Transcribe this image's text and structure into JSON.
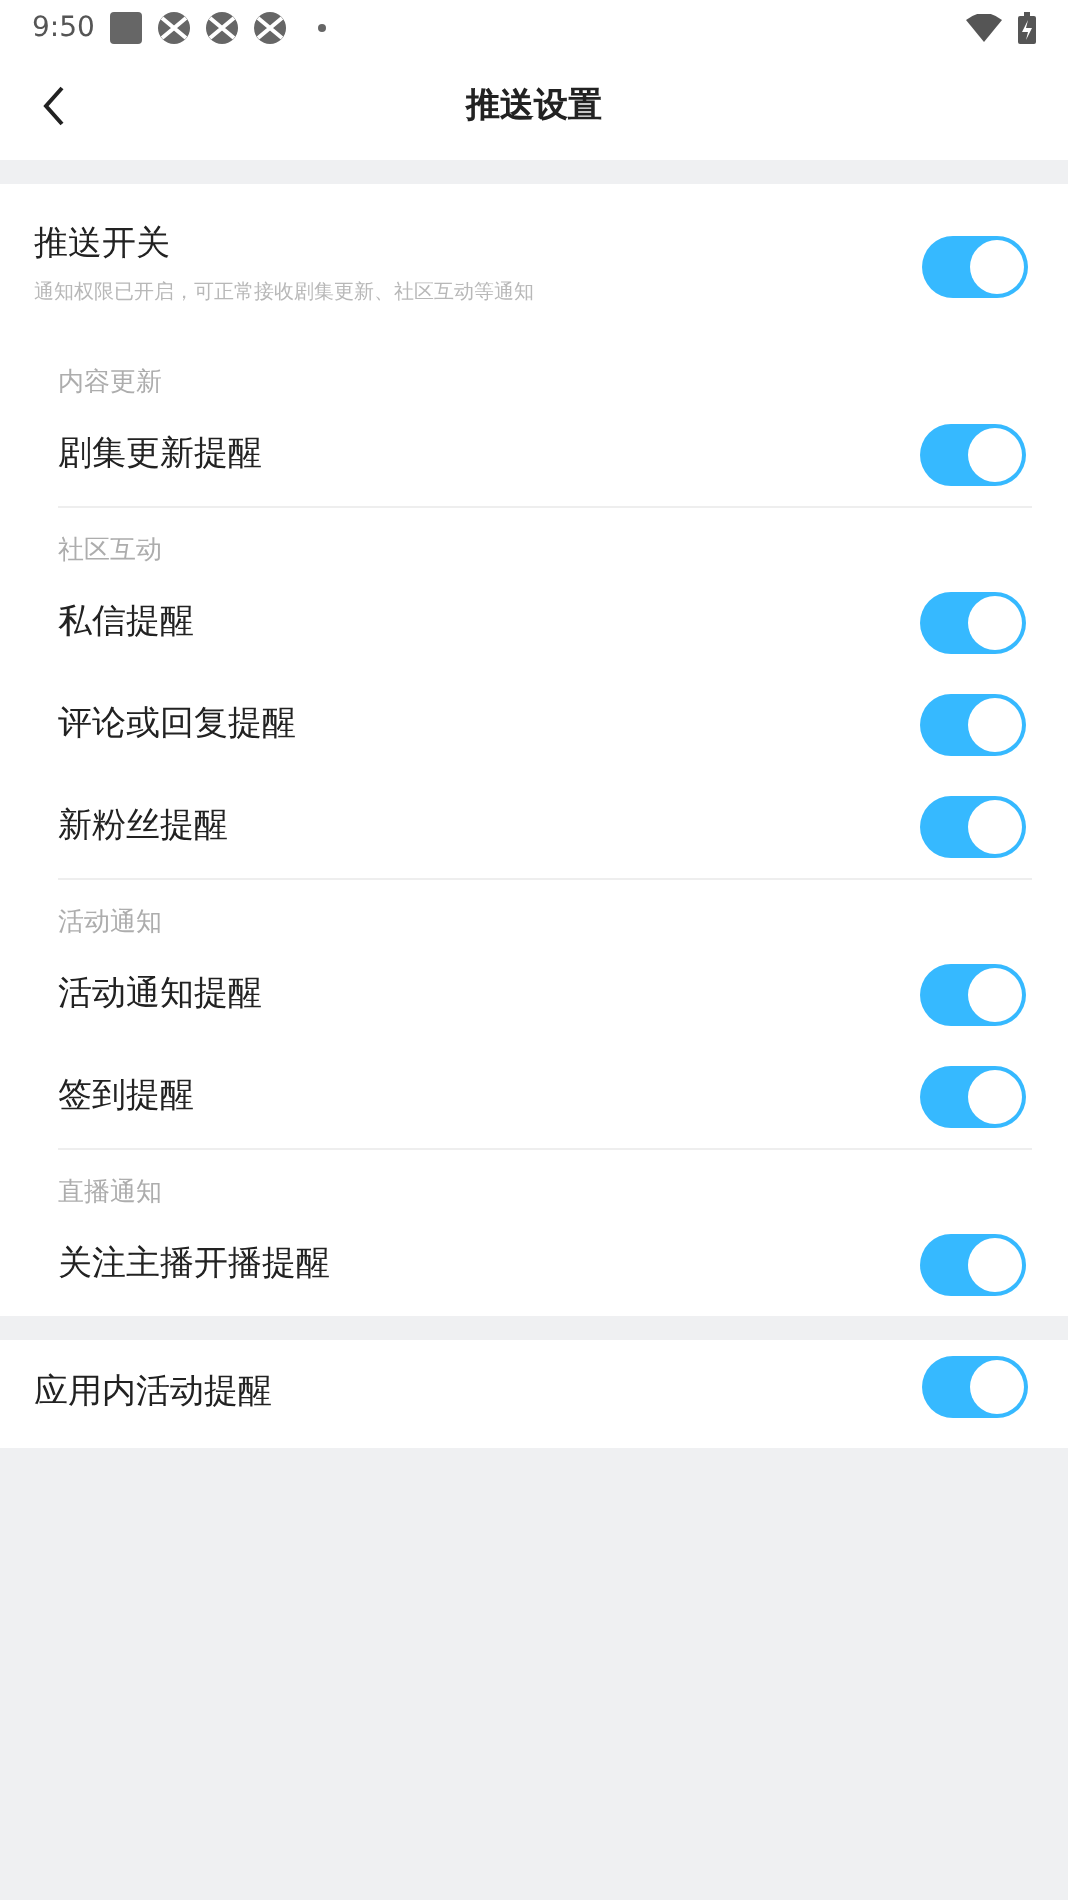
{
  "status_bar": {
    "time": "9:50"
  },
  "header": {
    "title": "推送设置"
  },
  "master": {
    "title": "推送开关",
    "subtitle": "通知权限已开启，可正常接收剧集更新、社区互动等通知",
    "on": true
  },
  "groups": [
    {
      "header": "内容更新",
      "items": [
        {
          "label": "剧集更新提醒",
          "on": true
        }
      ]
    },
    {
      "header": "社区互动",
      "items": [
        {
          "label": "私信提醒",
          "on": true
        },
        {
          "label": "评论或回复提醒",
          "on": true
        },
        {
          "label": "新粉丝提醒",
          "on": true
        }
      ]
    },
    {
      "header": "活动通知",
      "items": [
        {
          "label": "活动通知提醒",
          "on": true
        },
        {
          "label": "签到提醒",
          "on": true
        }
      ]
    },
    {
      "header": "直播通知",
      "items": [
        {
          "label": "关注主播开播提醒",
          "on": true
        }
      ]
    }
  ],
  "extra": {
    "label": "应用内活动提醒",
    "on": true
  }
}
